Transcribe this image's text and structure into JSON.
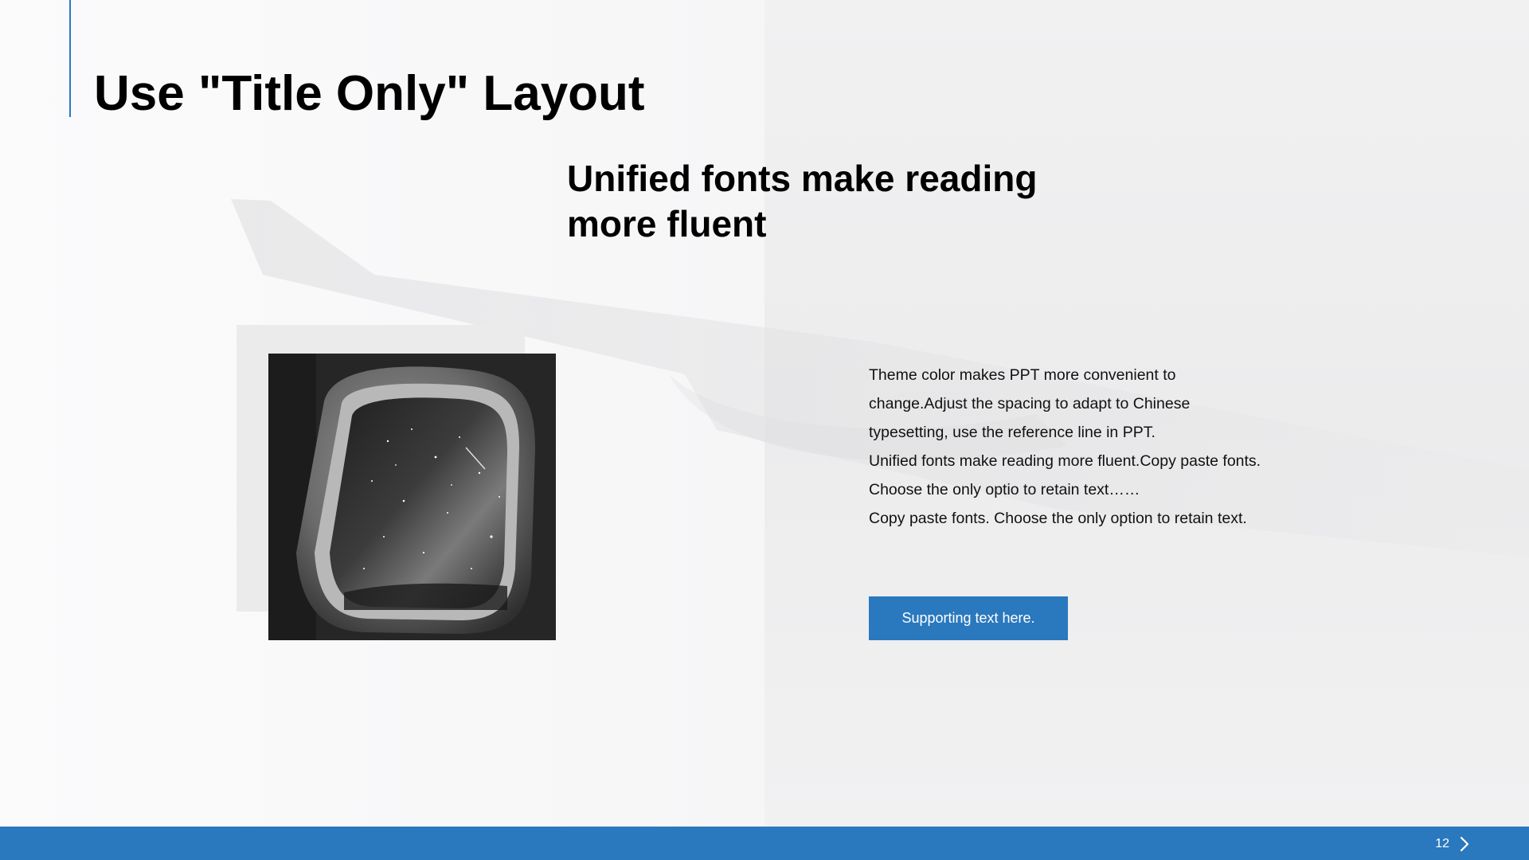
{
  "slide": {
    "title": "Use \"Title Only\" Layout",
    "subtitle": "Unified fonts make reading more fluent",
    "body_lines": [
      "Theme  color makes PPT more convenient  to",
      "change.Adjust  the spacing to adapt to Chinese",
      "typesetting, use the reference line  in  PPT.",
      "Unified  fonts make reading more fluent.Copy paste fonts.",
      "Choose  the only  optio to retain text……",
      "Copy paste  fonts. Choose the only option to retain text."
    ],
    "button_label": "Supporting text here.",
    "image_description_icon": "airplane-window-night-sky-photo"
  },
  "footer": {
    "page_number": "12",
    "next_icon": "chevron-right-icon"
  },
  "colors": {
    "accent": "#2a78bd",
    "title_text": "#000000",
    "body_text": "#111111",
    "background": "#f7f7f8"
  }
}
